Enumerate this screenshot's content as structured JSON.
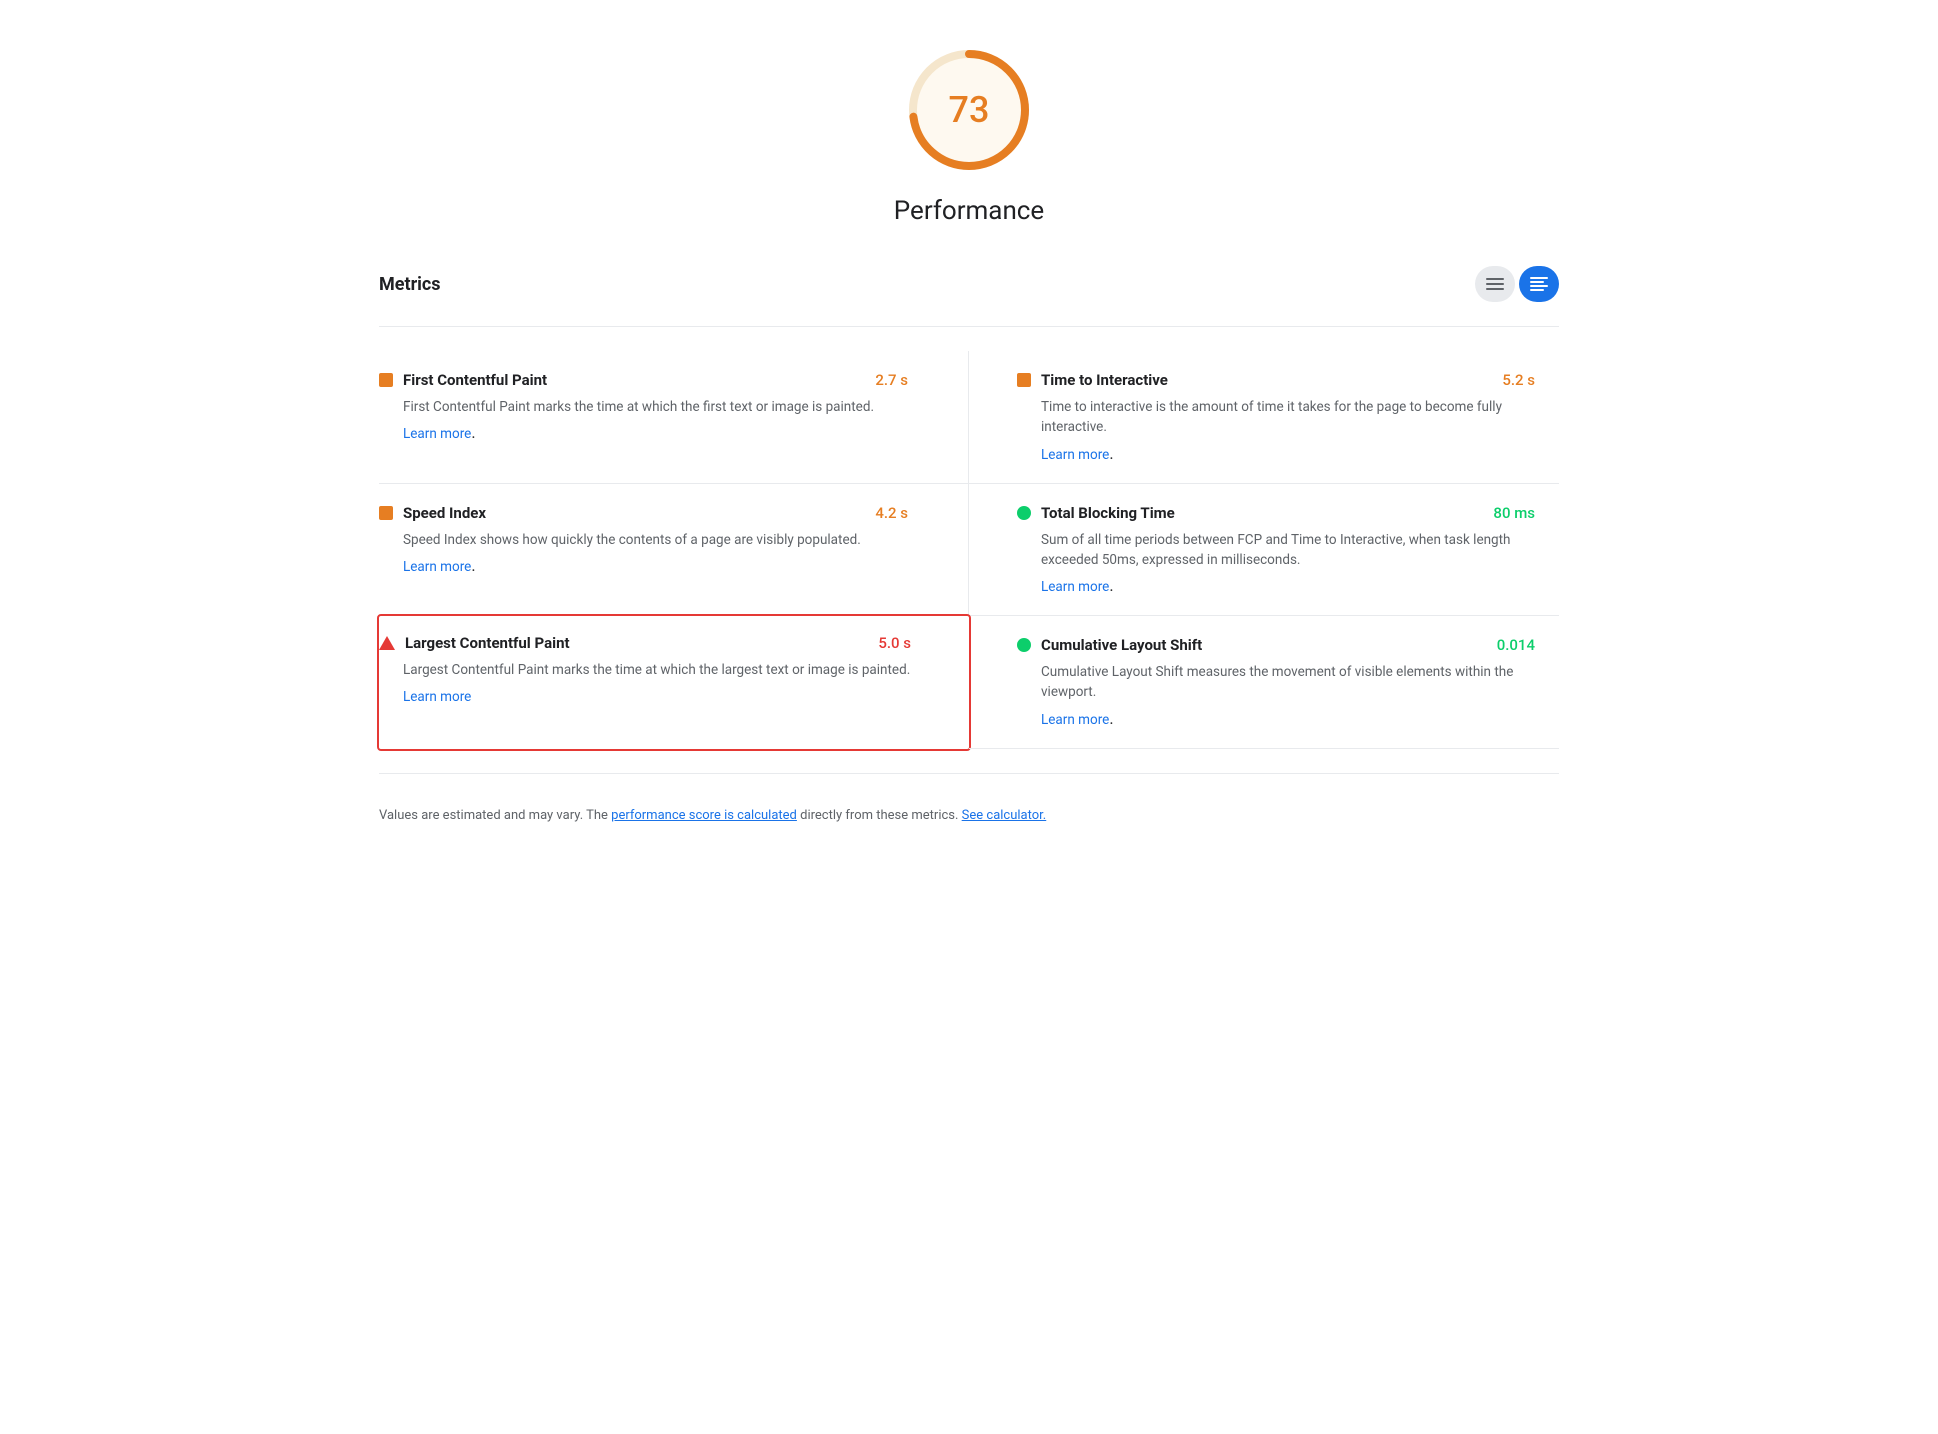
{
  "score": {
    "value": "73",
    "label": "Performance",
    "color": "#e67e22",
    "bg_color": "#fef9f0"
  },
  "metrics_section": {
    "title": "Metrics",
    "toggle_list_label": "≡",
    "toggle_detail_label": "≡"
  },
  "metrics": [
    {
      "id": "fcp",
      "name": "First Contentful Paint",
      "value": "2.7 s",
      "value_color": "orange",
      "icon": "orange-square",
      "description": "First Contentful Paint marks the time at which the first text or image is painted.",
      "learn_more_label": "Learn more",
      "learn_more_url": "#",
      "highlighted": false
    },
    {
      "id": "tti",
      "name": "Time to Interactive",
      "value": "5.2 s",
      "value_color": "orange",
      "icon": "orange-square",
      "description": "Time to interactive is the amount of time it takes for the page to become fully interactive.",
      "learn_more_label": "Learn more",
      "learn_more_url": "#",
      "highlighted": false
    },
    {
      "id": "si",
      "name": "Speed Index",
      "value": "4.2 s",
      "value_color": "orange",
      "icon": "orange-square",
      "description": "Speed Index shows how quickly the contents of a page are visibly populated.",
      "learn_more_label": "Learn more",
      "learn_more_url": "#",
      "highlighted": false
    },
    {
      "id": "tbt",
      "name": "Total Blocking Time",
      "value": "80 ms",
      "value_color": "green",
      "icon": "green-circle",
      "description": "Sum of all time periods between FCP and Time to Interactive, when task length exceeded 50ms, expressed in milliseconds.",
      "learn_more_label": "Learn more",
      "learn_more_url": "#",
      "highlighted": false
    },
    {
      "id": "lcp",
      "name": "Largest Contentful Paint",
      "value": "5.0 s",
      "value_color": "red",
      "icon": "red-triangle",
      "description": "Largest Contentful Paint marks the time at which the largest text or image is painted.",
      "learn_more_label": "Learn more",
      "learn_more_url": "#",
      "highlighted": true
    },
    {
      "id": "cls",
      "name": "Cumulative Layout Shift",
      "value": "0.014",
      "value_color": "green",
      "icon": "green-circle",
      "description": "Cumulative Layout Shift measures the movement of visible elements within the viewport.",
      "learn_more_label": "Learn more",
      "learn_more_url": "#",
      "highlighted": false
    }
  ],
  "footer": {
    "text_before": "Values are estimated and may vary. The ",
    "link1_label": "performance score is calculated",
    "link1_url": "#",
    "text_middle": " directly from these metrics. ",
    "link2_label": "See calculator.",
    "link2_url": "#"
  }
}
